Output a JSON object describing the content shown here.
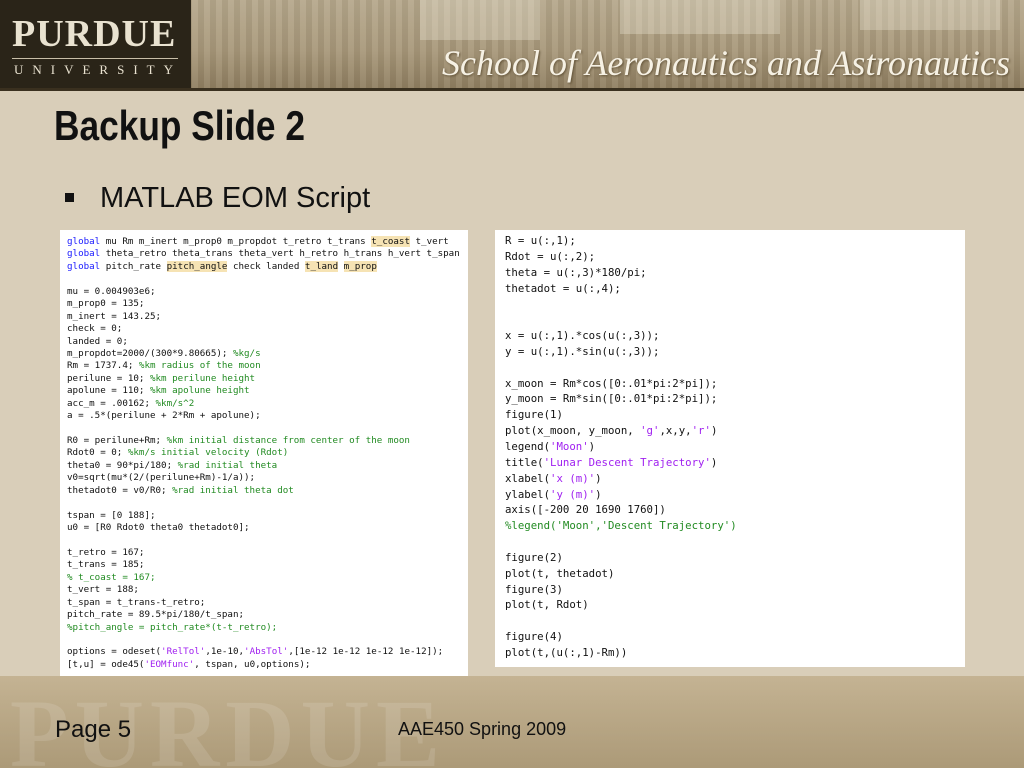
{
  "header": {
    "logo_main": "PURDUE",
    "logo_sub": "UNIVERSITY",
    "school_title": "School of Aeronautics and Astronautics"
  },
  "slide": {
    "title": "Backup Slide 2",
    "bullet": "MATLAB EOM Script"
  },
  "code_left": [
    [
      {
        "t": "global",
        "c": "kw"
      },
      {
        "t": " mu Rm m_inert m_prop0 m_propdot t_retro t_trans "
      },
      {
        "t": "t_coast",
        "c": "hl"
      },
      {
        "t": " t_vert"
      }
    ],
    [
      {
        "t": "global",
        "c": "kw"
      },
      {
        "t": " theta_retro theta_trans theta_vert h_retro h_trans h_vert t_span"
      }
    ],
    [
      {
        "t": "global",
        "c": "kw"
      },
      {
        "t": " pitch_rate "
      },
      {
        "t": "pitch_angle",
        "c": "hl"
      },
      {
        "t": " check landed "
      },
      {
        "t": "t_land",
        "c": "hl"
      },
      {
        "t": " "
      },
      {
        "t": "m_prop",
        "c": "hl"
      }
    ],
    [],
    [
      {
        "t": "mu = 0.004903e6;"
      }
    ],
    [
      {
        "t": "m_prop0 = 135;"
      }
    ],
    [
      {
        "t": "m_inert = 143.25;"
      }
    ],
    [
      {
        "t": "check = 0;"
      }
    ],
    [
      {
        "t": "landed = 0;"
      }
    ],
    [
      {
        "t": "m_propdot=2000/(300*9.80665); "
      },
      {
        "t": "%kg/s",
        "c": "cm"
      }
    ],
    [
      {
        "t": "Rm = 1737.4; "
      },
      {
        "t": "%km radius of the moon",
        "c": "cm"
      }
    ],
    [
      {
        "t": "perilune = 10; "
      },
      {
        "t": "%km perilune height",
        "c": "cm"
      }
    ],
    [
      {
        "t": "apolune = 110; "
      },
      {
        "t": "%km apolune height",
        "c": "cm"
      }
    ],
    [
      {
        "t": "acc_m = .00162; "
      },
      {
        "t": "%km/s^2",
        "c": "cm"
      }
    ],
    [
      {
        "t": "a = .5*(perilune + 2*Rm + apolune);"
      }
    ],
    [],
    [
      {
        "t": "R0 = perilune+Rm; "
      },
      {
        "t": "%km initial distance from center of the moon",
        "c": "cm"
      }
    ],
    [
      {
        "t": "Rdot0 = 0; "
      },
      {
        "t": "%km/s initial velocity (Rdot)",
        "c": "cm"
      }
    ],
    [
      {
        "t": "theta0 = 90*pi/180; "
      },
      {
        "t": "%rad initial theta",
        "c": "cm"
      }
    ],
    [
      {
        "t": "v0=sqrt(mu*(2/(perilune+Rm)-1/a));"
      }
    ],
    [
      {
        "t": "thetadot0 = v0/R0; "
      },
      {
        "t": "%rad initial theta dot",
        "c": "cm"
      }
    ],
    [],
    [
      {
        "t": "tspan = [0 188];"
      }
    ],
    [
      {
        "t": "u0 = [R0 Rdot0 theta0 thetadot0];"
      }
    ],
    [],
    [
      {
        "t": "t_retro = 167;"
      }
    ],
    [
      {
        "t": "t_trans = 185;"
      }
    ],
    [
      {
        "t": "% t_coast = 167;",
        "c": "cm"
      }
    ],
    [
      {
        "t": "t_vert = 188;"
      }
    ],
    [
      {
        "t": "t_span = t_trans-t_retro;"
      }
    ],
    [
      {
        "t": "pitch_rate = 89.5*pi/180/t_span;"
      }
    ],
    [
      {
        "t": "%pitch_angle = pitch_rate*(t-t_retro);",
        "c": "cm"
      }
    ],
    [],
    [
      {
        "t": "options = odeset("
      },
      {
        "t": "'RelTol'",
        "c": "st"
      },
      {
        "t": ",1e-10,"
      },
      {
        "t": "'AbsTol'",
        "c": "st"
      },
      {
        "t": ",[1e-12 1e-12 1e-12 1e-12]);"
      }
    ],
    [
      {
        "t": "[t,u] = ode45("
      },
      {
        "t": "'EOMfunc'",
        "c": "st"
      },
      {
        "t": ", tspan, u0,options);"
      }
    ]
  ],
  "code_right": [
    [
      {
        "t": "R = u(:,1);"
      }
    ],
    [
      {
        "t": "Rdot = u(:,2);"
      }
    ],
    [
      {
        "t": "theta = u(:,3)*180/pi;"
      }
    ],
    [
      {
        "t": "thetadot = u(:,4);"
      }
    ],
    [],
    [],
    [
      {
        "t": "x = u(:,1).*cos(u(:,3));"
      }
    ],
    [
      {
        "t": "y = u(:,1).*sin(u(:,3));"
      }
    ],
    [],
    [
      {
        "t": "x_moon = Rm*cos([0:.01*pi:2*pi]);"
      }
    ],
    [
      {
        "t": "y_moon = Rm*sin([0:.01*pi:2*pi]);"
      }
    ],
    [
      {
        "t": "figure(1)"
      }
    ],
    [
      {
        "t": "plot(x_moon, y_moon, "
      },
      {
        "t": "'g'",
        "c": "st"
      },
      {
        "t": ",x,y,"
      },
      {
        "t": "'r'",
        "c": "st"
      },
      {
        "t": ")"
      }
    ],
    [
      {
        "t": "legend("
      },
      {
        "t": "'Moon'",
        "c": "st"
      },
      {
        "t": ")"
      }
    ],
    [
      {
        "t": "title("
      },
      {
        "t": "'Lunar Descent Trajectory'",
        "c": "st"
      },
      {
        "t": ")"
      }
    ],
    [
      {
        "t": "xlabel("
      },
      {
        "t": "'x (m)'",
        "c": "st"
      },
      {
        "t": ")"
      }
    ],
    [
      {
        "t": "ylabel("
      },
      {
        "t": "'y (m)'",
        "c": "st"
      },
      {
        "t": ")"
      }
    ],
    [
      {
        "t": "axis([-200 20 1690 1760])"
      }
    ],
    [
      {
        "t": "%legend('Moon','Descent Trajectory')",
        "c": "cm"
      }
    ],
    [],
    [
      {
        "t": "figure(2)"
      }
    ],
    [
      {
        "t": "plot(t, thetadot)"
      }
    ],
    [
      {
        "t": "figure(3)"
      }
    ],
    [
      {
        "t": "plot(t, Rdot)"
      }
    ],
    [],
    [
      {
        "t": "figure(4)"
      }
    ],
    [
      {
        "t": "plot(t,(u(:,1)-Rm))"
      }
    ]
  ],
  "footer": {
    "page_label": "Page 5",
    "course": "AAE450 Spring 2009",
    "watermark": "PURDUE"
  }
}
